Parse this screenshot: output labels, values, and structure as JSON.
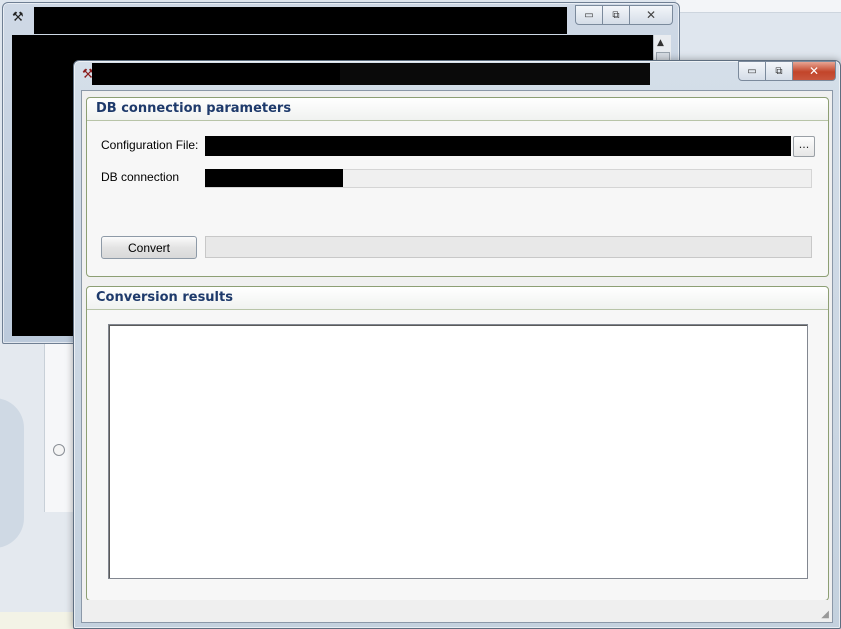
{
  "background_window": {
    "caption_buttons": {
      "minimize": "▭",
      "restore": "⧉",
      "close": "✕"
    }
  },
  "main_window": {
    "caption_buttons": {
      "minimize": "▭",
      "restore": "⧉",
      "close": "✕"
    },
    "db_group": {
      "title": "DB connection parameters",
      "config_label": "Configuration File:",
      "browse_label": "...",
      "db_label": "DB connection",
      "convert_label": "Convert"
    },
    "results_group": {
      "title": "Conversion results",
      "results_text": ""
    }
  },
  "icons": [
    "app-icon",
    "minimize-icon",
    "restore-icon",
    "close-icon",
    "scroll-up-icon",
    "resize-grip-icon"
  ],
  "colors": {
    "group_title": "#1e3a6b",
    "group_border": "#8d9f74",
    "close_button": "#c2452a"
  }
}
